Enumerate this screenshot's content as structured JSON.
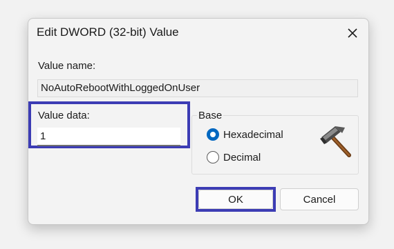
{
  "dialog": {
    "title": "Edit DWORD (32-bit) Value",
    "close_icon": "close-icon"
  },
  "value_name": {
    "label": "Value name:",
    "value": "NoAutoRebootWithLoggedOnUser"
  },
  "value_data": {
    "label": "Value data:",
    "value": "1"
  },
  "base": {
    "label": "Base",
    "options": [
      {
        "label": "Hexadecimal",
        "checked": true
      },
      {
        "label": "Decimal",
        "checked": false
      }
    ],
    "icon": "hammer-icon"
  },
  "buttons": {
    "ok": "OK",
    "cancel": "Cancel"
  },
  "colors": {
    "highlight": "#3c3cb4",
    "radio_accent": "#0067c0"
  }
}
